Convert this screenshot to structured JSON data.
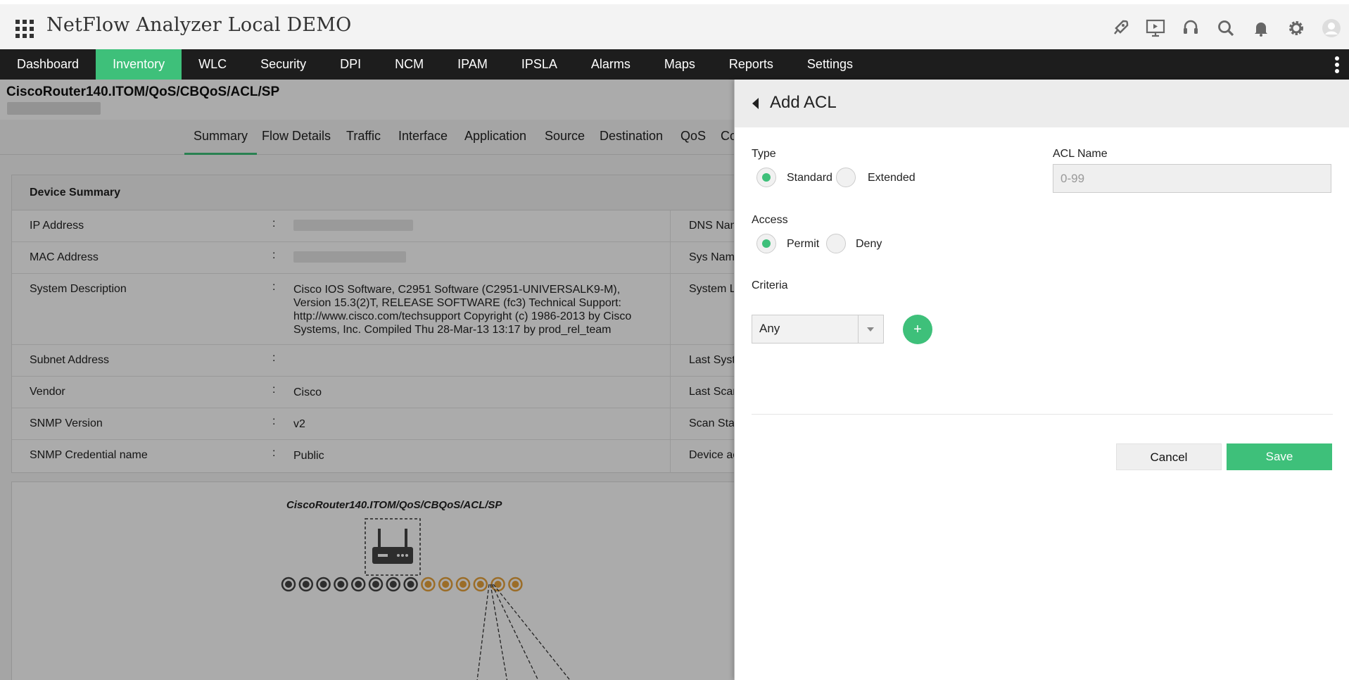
{
  "app": {
    "title": "NetFlow Analyzer Local DEMO"
  },
  "header_icons": [
    "rocket-icon",
    "presentation-icon",
    "headset-icon",
    "search-icon",
    "bell-icon",
    "gear-icon",
    "user-avatar-icon"
  ],
  "nav": {
    "items": [
      {
        "label": "Dashboard"
      },
      {
        "label": "Inventory",
        "active": true
      },
      {
        "label": "WLC"
      },
      {
        "label": "Security"
      },
      {
        "label": "DPI"
      },
      {
        "label": "NCM"
      },
      {
        "label": "IPAM"
      },
      {
        "label": "IPSLA"
      },
      {
        "label": "Alarms"
      },
      {
        "label": "Maps"
      },
      {
        "label": "Reports"
      },
      {
        "label": "Settings"
      }
    ]
  },
  "device": {
    "path": "CiscoRouter140.ITOM/QoS/CBQoS/ACL/SP"
  },
  "tabs": [
    "Summary",
    "Flow Details",
    "Traffic",
    "Interface",
    "Application",
    "Source",
    "Destination",
    "QoS",
    "Co"
  ],
  "summary": {
    "title": "Device Summary",
    "rows": [
      {
        "label": "IP Address",
        "value": "",
        "right_label": "DNS Nam"
      },
      {
        "label": "MAC Address",
        "value": "",
        "right_label": "Sys Name"
      },
      {
        "label": "System Description",
        "value": "Cisco IOS Software, C2951 Software (C2951-UNIVERSALK9-M), Version 15.3(2)T, RELEASE SOFTWARE (fc3) Technical Support: http://www.cisco.com/techsupport Copyright (c) 1986-2013 by Cisco Systems, Inc. Compiled Thu 28-Mar-13 13:17 by prod_rel_team",
        "right_label": "System L"
      },
      {
        "label": "Subnet Address",
        "value": "",
        "right_label": "Last Syst"
      },
      {
        "label": "Vendor",
        "value": "Cisco",
        "right_label": "Last Scan"
      },
      {
        "label": "SNMP Version",
        "value": "v2",
        "right_label": "Scan Stat"
      },
      {
        "label": "SNMP Credential name",
        "value": "Public",
        "right_label": "Device ac"
      }
    ]
  },
  "topology": {
    "title": "CiscoRouter140.ITOM/QoS/CBQoS/ACL/SP"
  },
  "panel": {
    "title": "Add ACL",
    "type_label": "Type",
    "type_options": [
      {
        "label": "Standard",
        "selected": true
      },
      {
        "label": "Extended",
        "selected": false
      }
    ],
    "acl_name_label": "ACL Name",
    "acl_name_placeholder": "0-99",
    "acl_name_value": "",
    "access_label": "Access",
    "access_options": [
      {
        "label": "Permit",
        "selected": true
      },
      {
        "label": "Deny",
        "selected": false
      }
    ],
    "criteria_label": "Criteria",
    "criteria_value": "Any",
    "add_button": "+",
    "cancel_label": "Cancel",
    "save_label": "Save"
  },
  "colors": {
    "accent": "#3ec07a",
    "nav_bg": "#1d1d1d",
    "port_grey": "#444444",
    "port_orange": "#e8a33c"
  }
}
